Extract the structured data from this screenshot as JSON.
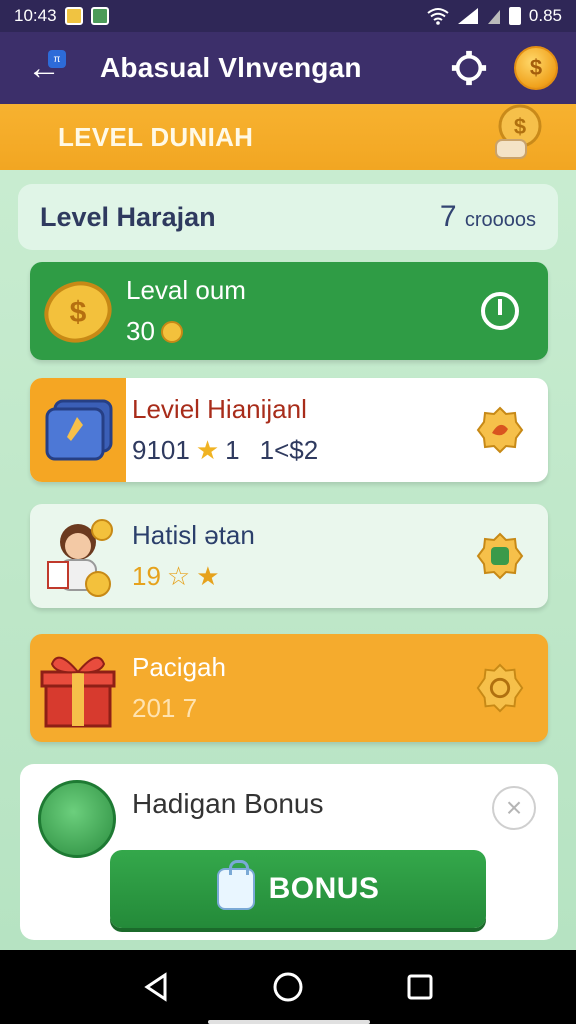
{
  "status_bar": {
    "time": "10:43",
    "battery": "0.85"
  },
  "app_bar": {
    "title": "Abasual Vlnvengan",
    "back_icon": "back-arrow-icon",
    "settings_icon": "gear-icon",
    "coin_icon": "coin-icon"
  },
  "banner": {
    "title": "LEVEL DUNIAH"
  },
  "main_card": {
    "title": "Level Harajan",
    "count": "7",
    "count_unit": "croooos"
  },
  "rows": [
    {
      "title": "Leval oum",
      "sub": "30",
      "icon": "coin-icon",
      "action_icon": "power-icon"
    },
    {
      "title": "Leviel Hianijanl",
      "sub_a": "9101",
      "sub_b": "1",
      "sub_c": "1<$2",
      "icon": "card-icon",
      "action_icon": "badge-icon"
    },
    {
      "title": "Hatisl ətan",
      "sub": "19",
      "icon": "avatar-icon",
      "action_icon": "badge-icon"
    },
    {
      "title": "Pacigah",
      "sub": "201 7",
      "icon": "gift-icon",
      "action_icon": "gear-badge-icon"
    }
  ],
  "bonus": {
    "title": "Hadigan Bonus",
    "button_label": "BONUS",
    "close_icon": "close-icon"
  },
  "colors": {
    "app_bar": "#3c2f6a",
    "banner": "#f2a622",
    "green": "#2f9c45",
    "orange": "#f5a623"
  }
}
